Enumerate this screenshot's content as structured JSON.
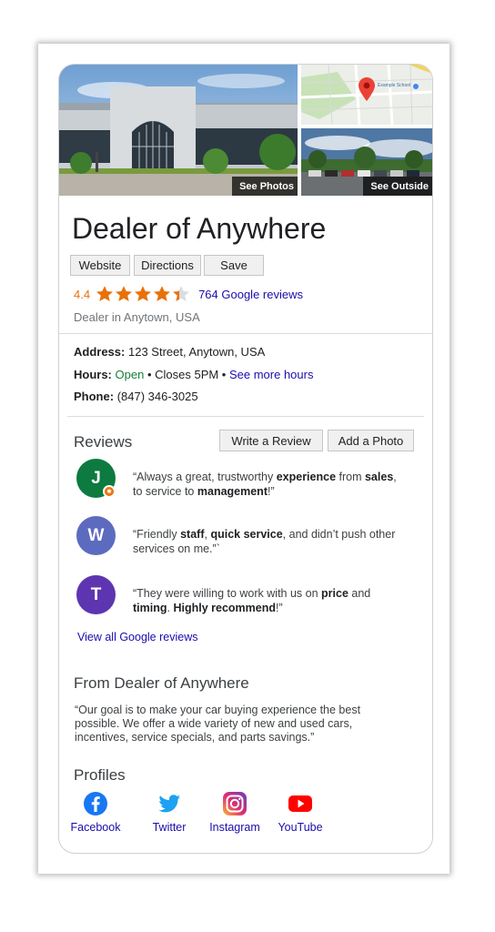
{
  "photos": {
    "main_label": "See Photos",
    "outside_label": "See Outside",
    "map_place": "Example School"
  },
  "business": {
    "name": "Dealer of Anywhere",
    "rating": "4.4",
    "rating_value": 4.4,
    "reviews_count_label": "764 Google reviews",
    "category": "Dealer in Anytown, USA"
  },
  "actions": {
    "website": "Website",
    "directions": "Directions",
    "save": "Save"
  },
  "info": {
    "address_label": "Address:",
    "address_value": "123 Street, Anytown, USA",
    "hours_label": "Hours:",
    "hours_status": "Open",
    "hours_closes": "• Closes 5PM •",
    "hours_more": "See more hours",
    "phone_label": "Phone:",
    "phone_value": "(847) 346-3025"
  },
  "reviews": {
    "title": "Reviews",
    "write_button": "Write a Review",
    "add_photo_button": "Add a Photo",
    "items": [
      {
        "initial": "J",
        "color": "#0d7a3f",
        "parts": [
          "“Always a great, trustworthy ",
          "experience",
          " from ",
          "sales",
          ", to service to ",
          "management",
          "!”"
        ]
      },
      {
        "initial": "W",
        "color": "#5c6bc0",
        "parts": [
          "“Friendly ",
          "staff",
          ", ",
          "quick service",
          ", and didn’t push other services on me.”`"
        ]
      },
      {
        "initial": "T",
        "color": "#5e35b1",
        "parts": [
          "“They were willing to work with us on ",
          "price",
          " and ",
          "timing",
          ". ",
          "Highly recommend",
          "!”"
        ]
      }
    ],
    "view_all": "View all Google reviews"
  },
  "about": {
    "title": "From Dealer of Anywhere",
    "text": "“Our goal is to make your car buying experience the best possible. We offer a wide variety of new and used cars, incentives, service specials, and parts savings.”"
  },
  "profiles": {
    "title": "Profiles",
    "items": [
      {
        "label": "Facebook",
        "icon": "facebook-icon"
      },
      {
        "label": "Twitter",
        "icon": "twitter-icon"
      },
      {
        "label": "Instagram",
        "icon": "instagram-icon"
      },
      {
        "label": "YouTube",
        "icon": "youtube-icon"
      }
    ]
  },
  "colors": {
    "link": "#1a0dab",
    "rating": "#e8710a",
    "open": "#188038",
    "star": "#e8710a"
  }
}
